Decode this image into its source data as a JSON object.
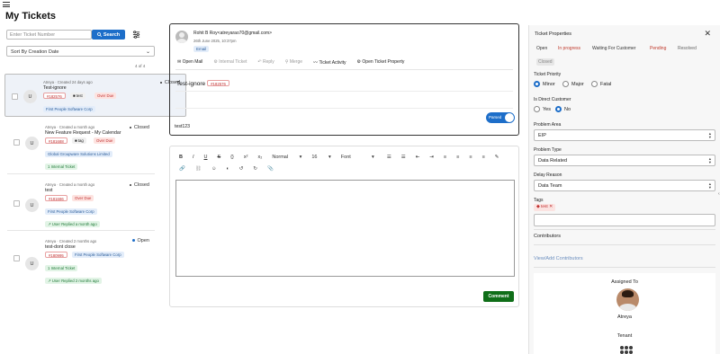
{
  "page": {
    "title": "My Tickets"
  },
  "left": {
    "search_placeholder": "Enter Ticket Number",
    "search_button": "Search",
    "sort": "Sort By Creation Date",
    "count": "4 of 4",
    "tickets": [
      {
        "avatar": "U",
        "meta": "Atreya   ·   Created 24 days ago",
        "subject": "Test-ignore",
        "status": "Closed",
        "id": "#182576",
        "tag": "test",
        "flag": "Over Due",
        "company": "First People Software Corp",
        "extra": ""
      },
      {
        "avatar": "U",
        "meta": "Atreya   ·   Created a month ago",
        "subject": "New Feature Request - My Calendar",
        "status": "Closed",
        "id": "#181688",
        "tag": "tag",
        "flag": "Over Due",
        "company": "Global Groupware Solutions Limited",
        "extra": "1 Internal Ticket"
      },
      {
        "avatar": "U",
        "meta": "Atreya   ·   Created a month ago",
        "subject": "test",
        "status": "Closed",
        "id": "#181686",
        "tag": "",
        "flag": "Over Due",
        "company": "First People Software Corp",
        "extra": "User Replied a month ago"
      },
      {
        "avatar": "U",
        "meta": "Atreya   ·   Created 2 months ago",
        "subject": "test-dont close",
        "status": "Open",
        "id": "#180995",
        "tag": "",
        "flag": "",
        "company": "First People Software Corp",
        "extra": "1 Internal Ticket",
        "extra2": "User Replied 2 months ago"
      }
    ]
  },
  "mail": {
    "from": "Rohit B Roy<atreyarao70@gmail.com>",
    "date": "26th June 2025, 10:37pm",
    "channel": "Email",
    "actions": [
      "Open Mail",
      "Internal Ticket",
      "Reply",
      "Merge",
      "Ticket Activity",
      "Open Ticket Property"
    ],
    "subject": "Test-ignore",
    "ticket_id": "#182576",
    "parsed_label": "Parsed",
    "body": "test123"
  },
  "editor": {
    "toolbar_row1": [
      "B",
      "I",
      "U",
      "S",
      "{}",
      "x²",
      "x₂",
      "Normal",
      "16",
      "Font"
    ],
    "comment_button": "Comment"
  },
  "props": {
    "title": "Ticket Properties",
    "status_tabs": [
      "Open",
      "In progress",
      "Waiting For Customer",
      "Pending",
      "Resolved",
      "Closed"
    ],
    "priority_label": "Ticket Priority",
    "priorities": [
      "Minor",
      "Major",
      "Fatal"
    ],
    "direct_label": "Is Direct Customer",
    "direct_options": [
      "Yes",
      "No"
    ],
    "problem_area_label": "Problem Area",
    "problem_area": "EIP",
    "problem_type_label": "Problem Type",
    "problem_type": "Data Related",
    "delay_label": "Delay Reason",
    "delay": "Data Team",
    "tags_label": "Tags",
    "tag": "test",
    "contributors_label": "Contributors",
    "view_contributors": "View/Add Contributors",
    "assigned_label": "Assigned To",
    "assignee": "Atreya",
    "tenant_label": "Tenant"
  }
}
